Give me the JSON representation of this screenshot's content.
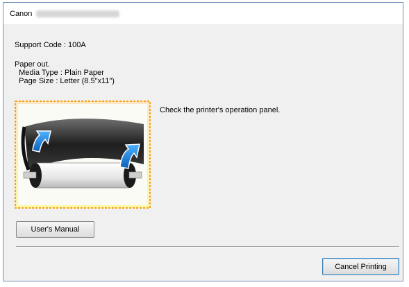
{
  "window": {
    "title": "Canon"
  },
  "support_code": "Support Code : 100A",
  "message": {
    "line1": "Paper out.",
    "line2": "  Media Type : Plain Paper",
    "line3": "  Page Size : Letter (8.5\"x11\")"
  },
  "instruction": "Check the printer's operation panel.",
  "buttons": {
    "users_manual": "User's Manual",
    "cancel_printing": "Cancel Printing"
  },
  "colors": {
    "illustration_border": "#f7a11a",
    "arrow": "#2c8fe3"
  }
}
